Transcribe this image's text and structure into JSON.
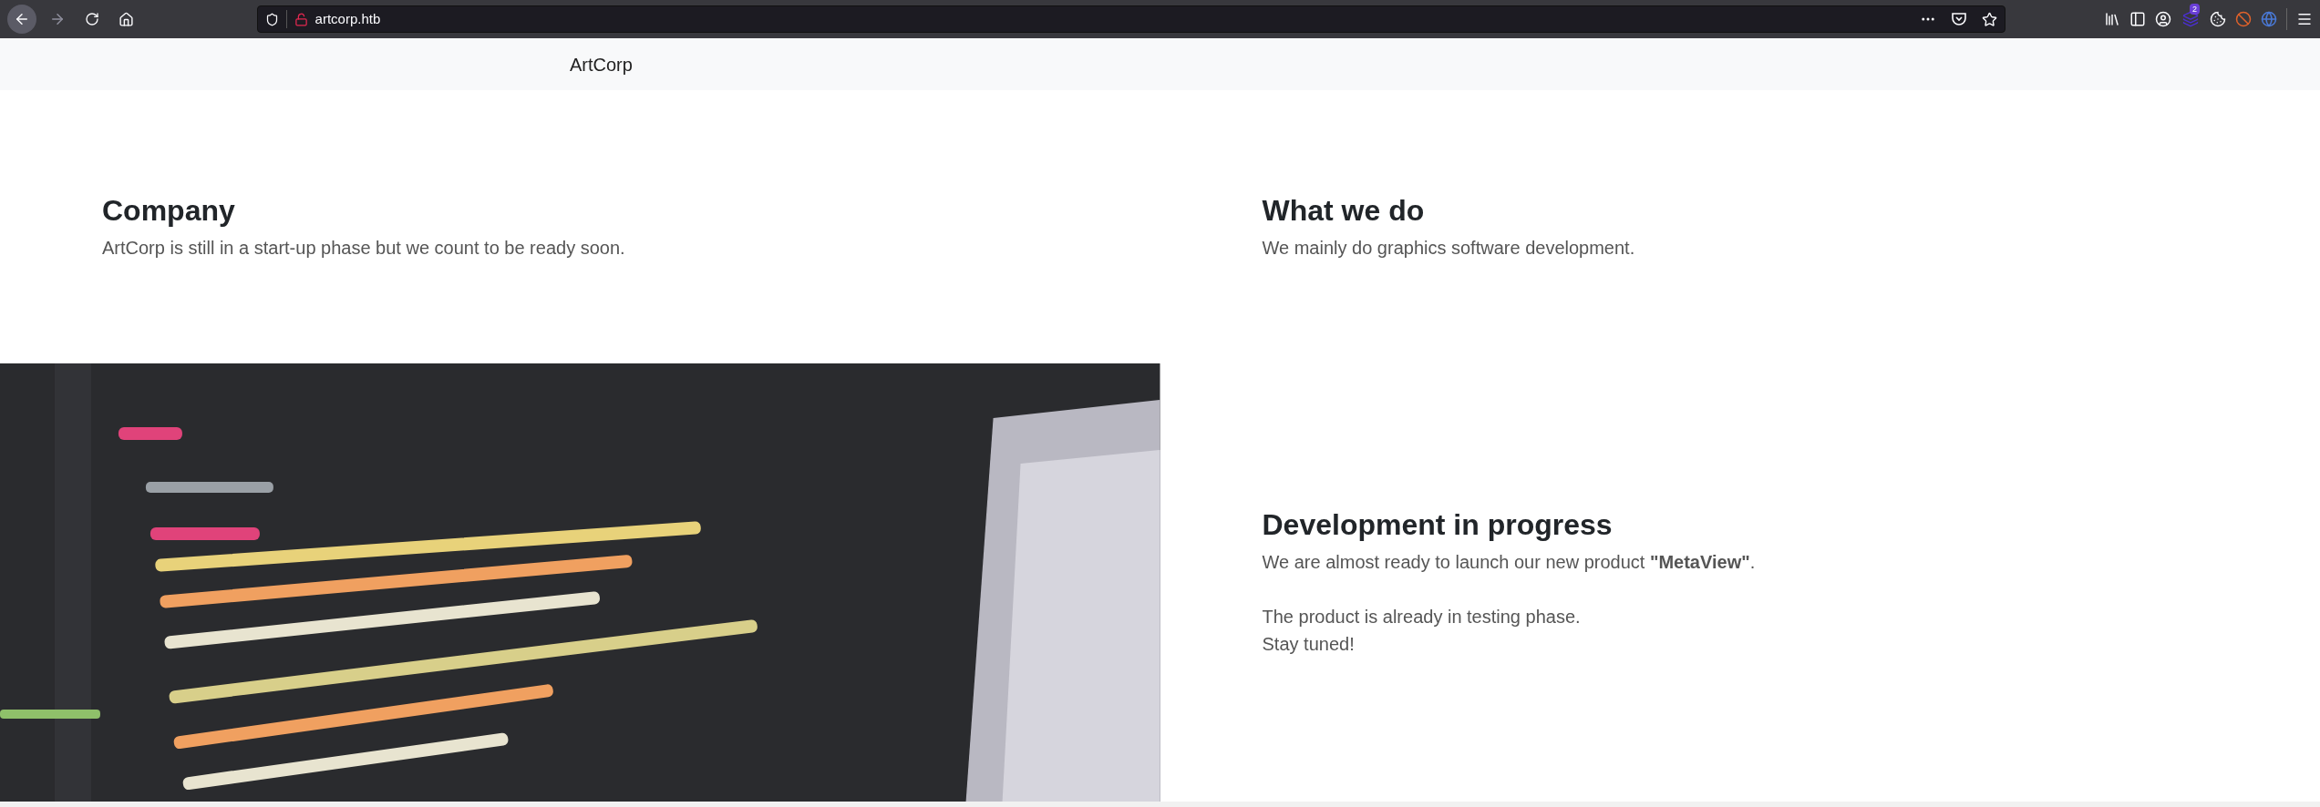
{
  "browser": {
    "url": "artcorp.htb",
    "extension_badge": "2"
  },
  "navbar": {
    "brand": "ArtCorp"
  },
  "intro": [
    {
      "title": "Company",
      "text": "ArtCorp is still in a start-up phase but we count to be ready soon."
    },
    {
      "title": "What we do",
      "text": "We mainly do graphics software development."
    }
  ],
  "feature": {
    "kind": "picture",
    "title": "Development in progress",
    "paragraphs": [
      "We are almost ready to launch our new product **\"MetaView\"**.",
      "The product is already in testing phase.",
      "Stay tuned!"
    ]
  }
}
